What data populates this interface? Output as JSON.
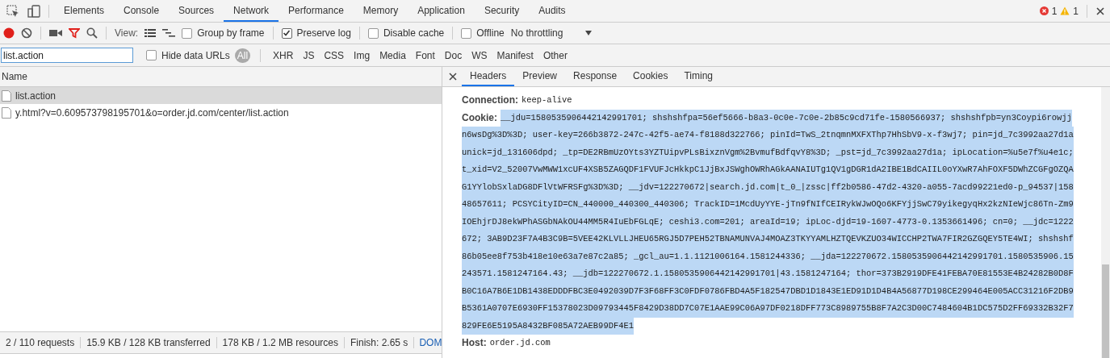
{
  "top_tabs": [
    {
      "label": "Elements",
      "selected": false
    },
    {
      "label": "Console",
      "selected": false
    },
    {
      "label": "Sources",
      "selected": false
    },
    {
      "label": "Network",
      "selected": true
    },
    {
      "label": "Performance",
      "selected": false
    },
    {
      "label": "Memory",
      "selected": false
    },
    {
      "label": "Application",
      "selected": false
    },
    {
      "label": "Security",
      "selected": false
    },
    {
      "label": "Audits",
      "selected": false
    }
  ],
  "issues": {
    "errors": "1",
    "warnings": "1"
  },
  "toolbar": {
    "recording": true,
    "view_label": "View:",
    "checkboxes": [
      {
        "label": "Group by frame",
        "checked": false
      },
      {
        "label": "Preserve log",
        "checked": true
      },
      {
        "label": "Disable cache",
        "checked": false
      },
      {
        "label": "Offline",
        "checked": false
      }
    ],
    "throttling": "No throttling"
  },
  "filter": {
    "value": "list.action",
    "hide_data_urls": {
      "label": "Hide data URLs",
      "checked": false
    },
    "types": [
      {
        "label": "All",
        "selected": true
      },
      {
        "label": "XHR",
        "selected": false
      },
      {
        "label": "JS",
        "selected": false
      },
      {
        "label": "CSS",
        "selected": false
      },
      {
        "label": "Img",
        "selected": false
      },
      {
        "label": "Media",
        "selected": false
      },
      {
        "label": "Font",
        "selected": false
      },
      {
        "label": "Doc",
        "selected": false
      },
      {
        "label": "WS",
        "selected": false
      },
      {
        "label": "Manifest",
        "selected": false
      },
      {
        "label": "Other",
        "selected": false
      }
    ]
  },
  "requests": {
    "column": "Name",
    "rows": [
      {
        "name": "list.action",
        "selected": true
      },
      {
        "name": "y.html?v=0.609573798195701&o=order.jd.com/center/list.action",
        "selected": false
      }
    ]
  },
  "detail_tabs": [
    {
      "label": "Headers",
      "selected": true
    },
    {
      "label": "Preview",
      "selected": false
    },
    {
      "label": "Response",
      "selected": false
    },
    {
      "label": "Cookies",
      "selected": false
    },
    {
      "label": "Timing",
      "selected": false
    }
  ],
  "headers": [
    {
      "name": "Connection:",
      "highlighted": false,
      "value_lines": [
        "keep-alive"
      ]
    },
    {
      "name": "Cookie:",
      "highlighted": true,
      "value_lines": [
        "__jdu=1580535906442142991701; shshshfpa=56ef5666-b8a3-0c0e-7c0e-2b85c9cd71fe-1580566937; shshshfpb=yn3Coypi6rowjj",
        "n6wsDg%3D%3D; user-key=266b3872-247c-42f5-ae74-f8188d322766; pinId=TwS_2tnqmnMXFXThp7HhSbV9-x-f3wj7; pin=jd_7c3992aa27d1a",
        "unick=jd_131606dpd; _tp=DE2RBmUzOYts3YZTUipvPLsBixznVgm%2BvmufBdfqvY8%3D; _pst=jd_7c3992aa27d1a; ipLocation=%u5e7f%u4e1c;",
        "t_xid=V2_52007VwMWW1xcUF4XSB5ZAGQDF1FVUFJcHkkpC1JjBxJSWghOWRhAGkAANAIUTg1QV1gDGR1dA2IBE1BdCAIIL0oYXwR7AhFOXF5DWhZCGFgOZQA",
        "G1YYlobSxlaDG8DFlVtWFRSFg%3D%3D; __jdv=122270672|search.jd.com|t_0_|zssc|ff2b0586-47d2-4320-a055-7acd99221ed0-p_94537|158",
        "48657611; PCSYCityID=CN_440000_440300_440306; TrackID=1McdUyYYE-jTn9fNIfCEIRykWJwOQo6KFYjjSwC79yikegyqHx2kzNIeWjc86Tn-Zm9",
        "IOEhjrDJ8ekWPhASGbNAkOU44MM5R4IuEbFGLqE; ceshi3.com=201; areaId=19; ipLoc-djd=19-1607-4773-0.1353661496; cn=0; __jdc=1222",
        "672; 3AB9D23F7A4B3C9B=5VEE42KLVLLJHEU65RGJ5D7PEH52TBNAMUNVAJ4MOAZ3TKYYAMLHZTQEVKZUO34WICCHP2TWA7FIR2GZGQEY5TE4WI; shshshf",
        "86b05ee8f753b418e10e63a7e87c2a85; _gcl_au=1.1.1121006164.1581244336; __jda=122270672.1580535906442142991701.1580535906.15",
        "243571.1581247164.43; __jdb=122270672.1.1580535906442142991701|43.1581247164; thor=373B2919DFE41FEBA70E81553E4B24282B0D8F",
        "B0C16A7B6E1DB1438EDDDFBC3E0492039D7F3F68FF3C0FDF0786FBD4A5F182547DBD1D1843E1ED91D1D4B4A56877D198CE299464E005ACC31216F2DB9",
        "B5361A0707E6930FF15378023D09793445F8429D38DD7C07E1AAE99C06A97DF0218DFF773C8989755B8F7A2C3D00C7484604B1DC575D2FF69332B32F7",
        "829FE6E5195A8432BF085A72AEB99DF4E1"
      ]
    },
    {
      "name": "Host:",
      "highlighted": false,
      "value_lines": [
        "order.jd.com"
      ]
    }
  ],
  "status_bar": [
    "2 / 110 requests",
    "15.9 KB / 128 KB transferred",
    "178 KB / 1.2 MB resources",
    "Finish: 2.65 s",
    "DOM"
  ]
}
